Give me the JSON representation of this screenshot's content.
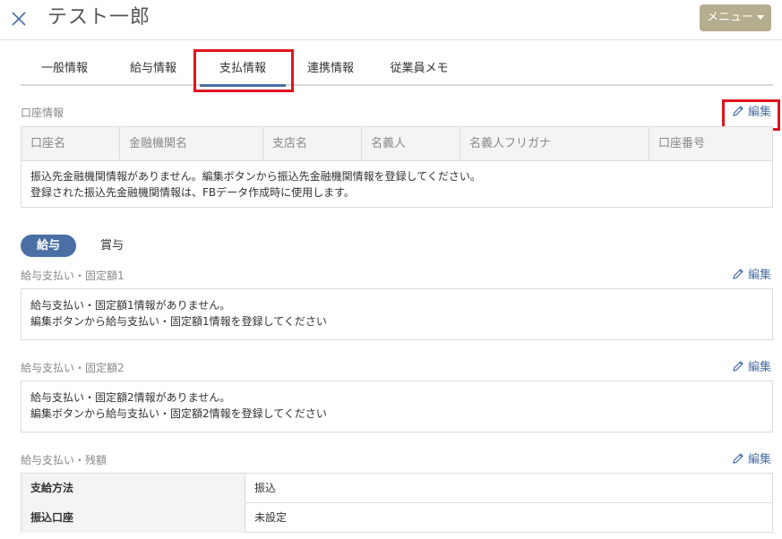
{
  "header": {
    "title": "テスト一郎",
    "menu_label": "メニュー"
  },
  "tabs": [
    {
      "label": "一般情報"
    },
    {
      "label": "給与情報"
    },
    {
      "label": "支払情報"
    },
    {
      "label": "連携情報"
    },
    {
      "label": "従業員メモ"
    }
  ],
  "account": {
    "section_label": "口座情報",
    "edit_label": "編集",
    "columns": [
      "口座名",
      "金融機関名",
      "支店名",
      "名義人",
      "名義人フリガナ",
      "口座番号"
    ],
    "empty_line1": "振込先金融機関情報がありません。編集ボタンから振込先金融機関情報を登録してください。",
    "empty_line2": "登録された振込先金融機関情報は、FBデータ作成時に使用します。"
  },
  "pay_toggle": {
    "salary": "給与",
    "bonus": "賞与"
  },
  "fixed1": {
    "label": "給与支払い・固定額1",
    "edit_label": "編集",
    "line1": "給与支払い・固定額1情報がありません。",
    "line2": "編集ボタンから給与支払い・固定額1情報を登録してください"
  },
  "fixed2": {
    "label": "給与支払い・固定額2",
    "edit_label": "編集",
    "line1": "給与支払い・固定額2情報がありません。",
    "line2": "編集ボタンから給与支払い・固定額2情報を登録してください"
  },
  "remainder": {
    "label": "給与支払い・残額",
    "edit_label": "編集",
    "rows": [
      {
        "key": "支給方法",
        "value": "振込"
      },
      {
        "key": "振込口座",
        "value": "未設定"
      }
    ]
  },
  "colors": {
    "accent": "#4a6fa5",
    "menu_button": "#b5ad8f",
    "highlight": "#e0141e"
  }
}
